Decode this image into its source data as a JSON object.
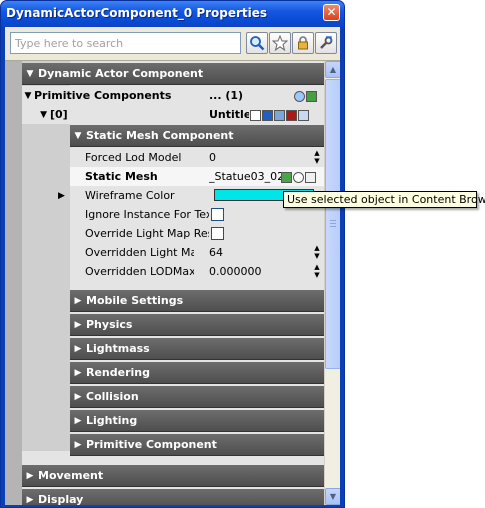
{
  "window": {
    "title": "DynamicActorComponent_0 Properties",
    "close_glyph": "✕"
  },
  "search": {
    "placeholder": "Type here to search"
  },
  "toolbar": {
    "icons": [
      "magnifier-icon",
      "star-icon",
      "lock-icon",
      "wrench-icon"
    ]
  },
  "sections": {
    "dynamic_actor": "Dynamic Actor Component",
    "static_mesh": "Static Mesh Component",
    "mobile": "Mobile Settings",
    "physics": "Physics",
    "lightmass": "Lightmass",
    "rendering": "Rendering",
    "collision": "Collision",
    "lighting": "Lighting",
    "primitive": "Primitive Component",
    "movement": "Movement",
    "partial": "Display"
  },
  "primitive_components": {
    "label": "Primitive Components",
    "value": "... (1)"
  },
  "element": {
    "label": "[0]",
    "value": "Untitle"
  },
  "props": {
    "forced_lod": {
      "label": "Forced Lod Model",
      "value": "0"
    },
    "static_mesh": {
      "label": "Static Mesh",
      "value": "_Statue03_02"
    },
    "wireframe": {
      "label": "Wireframe Color",
      "color": "#00e5e5"
    },
    "ignore_instance": {
      "label": "Ignore Instance For Text"
    },
    "override_lightmap": {
      "label": "Override Light Map Res"
    },
    "overridden_lightmap": {
      "label": "Overridden Light Map Res",
      "value": "64"
    },
    "overridden_lodmax": {
      "label": "Overridden LODMax Range",
      "value": "0.000000"
    }
  },
  "tooltip": {
    "text": "Use selected object in Content Browser"
  },
  "colors": {
    "title_bar": "#0a49d2",
    "header_dark": "#555555",
    "wire_color": "#00e5e5"
  }
}
